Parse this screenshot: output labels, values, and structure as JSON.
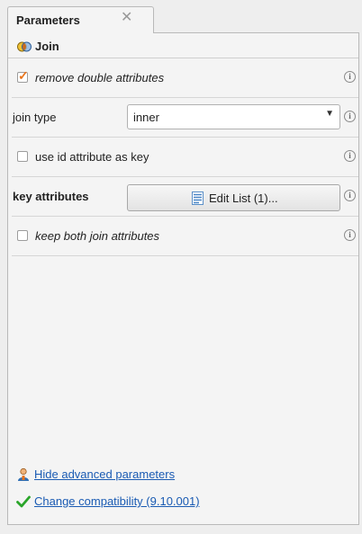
{
  "tab": {
    "title": "Parameters",
    "close_glyph": "✕"
  },
  "operator": {
    "name": "Join",
    "icon": "join-icon"
  },
  "params": {
    "remove_double": {
      "label": "remove double attributes",
      "checked": true
    },
    "join_type": {
      "label": "join type",
      "value": "inner"
    },
    "use_id": {
      "label": "use id attribute as key",
      "checked": false
    },
    "key_attributes": {
      "label": "key attributes",
      "button_label": "Edit List (1)..."
    },
    "keep_both": {
      "label": "keep both join attributes",
      "checked": false
    }
  },
  "info_glyph": "i",
  "links": {
    "advanced": "Hide advanced parameters",
    "compatibility": "Change compatibility (9.10.001)"
  },
  "colors": {
    "accent": "#e8741c",
    "link": "#1a5bb3",
    "check_green": "#2aa52a"
  }
}
